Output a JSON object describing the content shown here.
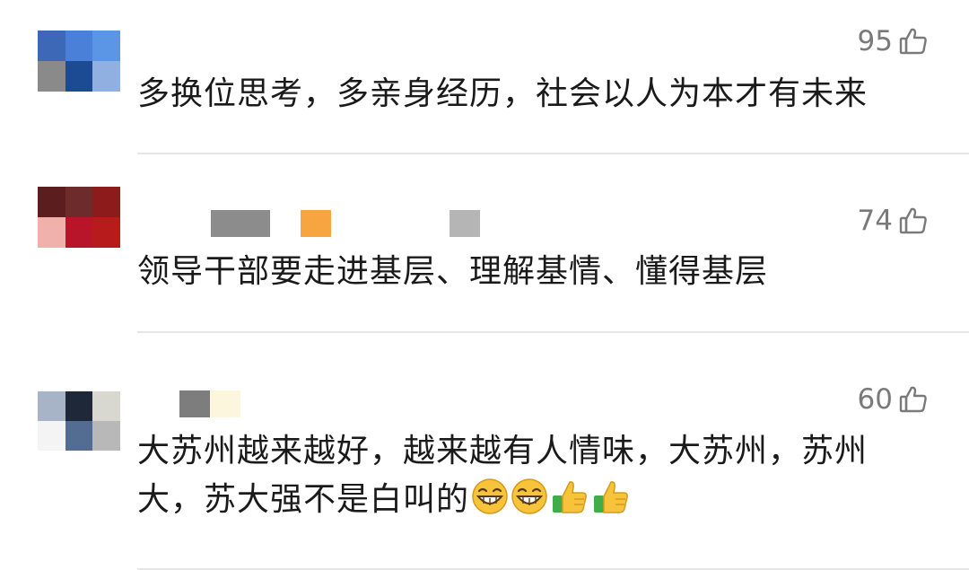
{
  "comments": [
    {
      "likes": "95",
      "text": "多换位思考，多亲身经历，社会以人为本才有未来",
      "avatar_colors": [
        "#3d68b7",
        "#4a80d8",
        "#5b95e6",
        "#8a8a8a",
        "#1c4b94",
        "#8fb0e0"
      ]
    },
    {
      "likes": "74",
      "text": "领导干部要走进基层、理解基情、懂得基层",
      "avatar_colors": [
        "#5b1d1d",
        "#6e2b2b",
        "#8e1b1b",
        "#f0b0ab",
        "#b8152a",
        "#b81b1b"
      ]
    },
    {
      "likes": "60",
      "text_line1": "大苏州越来越好，越来越有人情味，大苏州，苏州",
      "text_line2": "大，苏大强不是白叫的",
      "emojis": [
        "grin-emoji",
        "grin-emoji",
        "thumbs-up-emoji",
        "thumbs-up-emoji"
      ],
      "avatar_colors": [
        "#a7b4c7",
        "#1f2838",
        "#d8d8d0",
        "#f4f4f4",
        "#526d91",
        "#b8b8b8"
      ]
    }
  ],
  "colors": {
    "like_text": "#7a7a7a",
    "comment_text": "#1a1a1a",
    "divider": "#e6e6e6"
  }
}
